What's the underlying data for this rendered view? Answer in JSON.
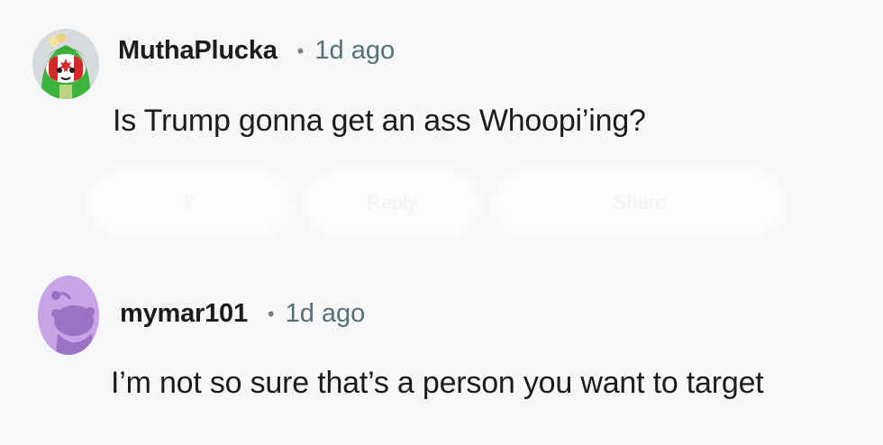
{
  "comments": [
    {
      "username": "MuthaPlucka",
      "separator": "•",
      "timestamp": "1d ago",
      "body": "Is Trump gonna get an ass Whoopi’ing?",
      "avatar": "snoo-avatar-green-hood-canada",
      "actions": {
        "reply_label": "Reply",
        "share_label": "Share"
      }
    },
    {
      "username": "mymar101",
      "separator": "•",
      "timestamp": "1d ago",
      "body": "I’m not so sure that’s a person you want to target",
      "avatar": "default-snoo-avatar-purple"
    }
  ],
  "colors": {
    "background": "#f6f7f8",
    "username": "#1c1c1c",
    "timestamp": "#576f76",
    "avatar_purple": "#c9a3e6",
    "snoo_purple": "#9a72c6",
    "hood_green": "#3db33d"
  }
}
